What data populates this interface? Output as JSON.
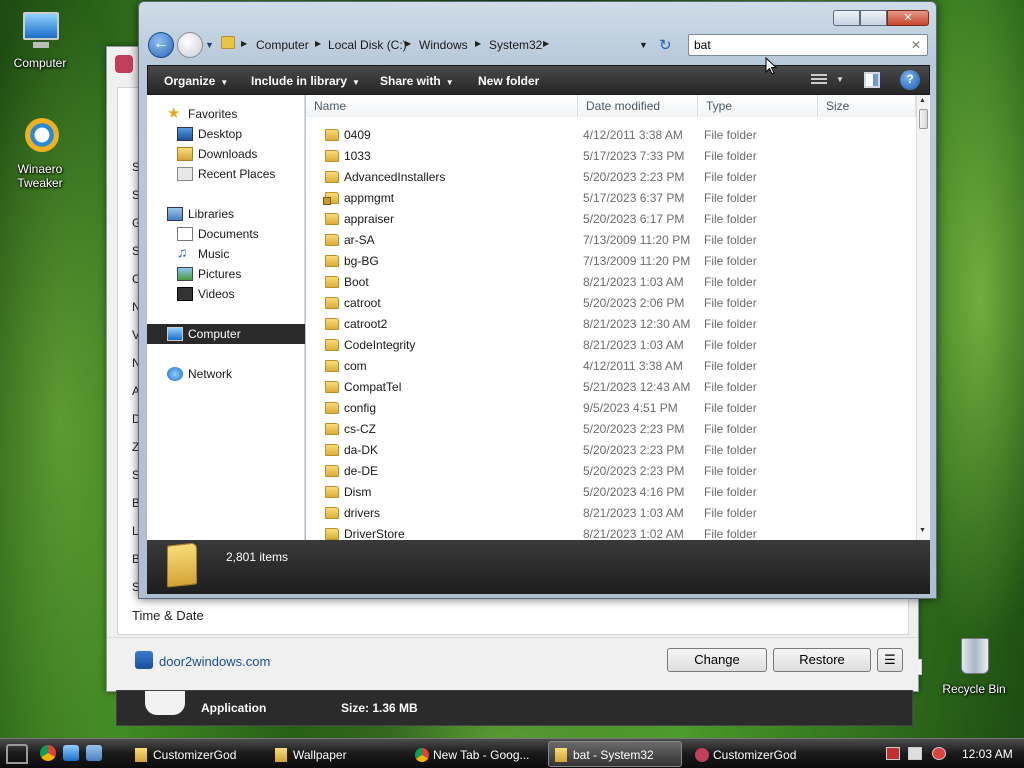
{
  "desktop": {
    "icons": [
      {
        "label": "Computer"
      },
      {
        "label": "Winaero Tweaker"
      },
      {
        "label": "Recycle Bin"
      }
    ]
  },
  "customizer": {
    "left_letters": [
      "S",
      "S",
      "G",
      "S",
      "C",
      "N",
      "V",
      "N",
      "A",
      "D",
      "Z",
      "S",
      "B",
      "L",
      "B",
      "S"
    ],
    "time_date_label": "Time & Date",
    "link": "door2windows.com",
    "change_button": "Change",
    "restore_button": "Restore",
    "menu_button": "☰",
    "bottom_type": "Application",
    "bottom_size": "Size: 1.36 MB"
  },
  "explorer": {
    "breadcrumbs": [
      "Computer",
      "Local Disk (C:)",
      "Windows",
      "System32"
    ],
    "search_value": "bat",
    "toolbar": {
      "organize": "Organize",
      "include": "Include in library",
      "share": "Share with",
      "new_folder": "New folder"
    },
    "nav": {
      "favorites": "Favorites",
      "desktop": "Desktop",
      "downloads": "Downloads",
      "recent": "Recent Places",
      "libraries": "Libraries",
      "documents": "Documents",
      "music": "Music",
      "pictures": "Pictures",
      "videos": "Videos",
      "computer": "Computer",
      "network": "Network"
    },
    "columns": {
      "name": "Name",
      "date": "Date modified",
      "type": "Type",
      "size": "Size"
    },
    "files": [
      {
        "name": "0409",
        "date": "4/12/2011 3:38 AM",
        "type": "File folder"
      },
      {
        "name": "1033",
        "date": "5/17/2023 7:33 PM",
        "type": "File folder"
      },
      {
        "name": "AdvancedInstallers",
        "date": "5/20/2023 2:23 PM",
        "type": "File folder"
      },
      {
        "name": "appmgmt",
        "date": "5/17/2023 6:37 PM",
        "type": "File folder"
      },
      {
        "name": "appraiser",
        "date": "5/20/2023 6:17 PM",
        "type": "File folder"
      },
      {
        "name": "ar-SA",
        "date": "7/13/2009 11:20 PM",
        "type": "File folder"
      },
      {
        "name": "bg-BG",
        "date": "7/13/2009 11:20 PM",
        "type": "File folder"
      },
      {
        "name": "Boot",
        "date": "8/21/2023 1:03 AM",
        "type": "File folder"
      },
      {
        "name": "catroot",
        "date": "5/20/2023 2:06 PM",
        "type": "File folder"
      },
      {
        "name": "catroot2",
        "date": "8/21/2023 12:30 AM",
        "type": "File folder"
      },
      {
        "name": "CodeIntegrity",
        "date": "8/21/2023 1:03 AM",
        "type": "File folder"
      },
      {
        "name": "com",
        "date": "4/12/2011 3:38 AM",
        "type": "File folder"
      },
      {
        "name": "CompatTel",
        "date": "5/21/2023 12:43 AM",
        "type": "File folder"
      },
      {
        "name": "config",
        "date": "9/5/2023 4:51 PM",
        "type": "File folder"
      },
      {
        "name": "cs-CZ",
        "date": "5/20/2023 2:23 PM",
        "type": "File folder"
      },
      {
        "name": "da-DK",
        "date": "5/20/2023 2:23 PM",
        "type": "File folder"
      },
      {
        "name": "de-DE",
        "date": "5/20/2023 2:23 PM",
        "type": "File folder"
      },
      {
        "name": "Dism",
        "date": "5/20/2023 4:16 PM",
        "type": "File folder"
      },
      {
        "name": "drivers",
        "date": "8/21/2023 1:03 AM",
        "type": "File folder"
      },
      {
        "name": "DriverStore",
        "date": "8/21/2023 1:02 AM",
        "type": "File folder"
      }
    ],
    "item_count": "2,801 items"
  },
  "taskbar": {
    "tasks": [
      {
        "label": "CustomizerGod"
      },
      {
        "label": "Wallpaper"
      },
      {
        "label": "New Tab - Goog..."
      },
      {
        "label": "bat - System32"
      },
      {
        "label": "CustomizerGod"
      }
    ],
    "clock": "12:03 AM"
  }
}
